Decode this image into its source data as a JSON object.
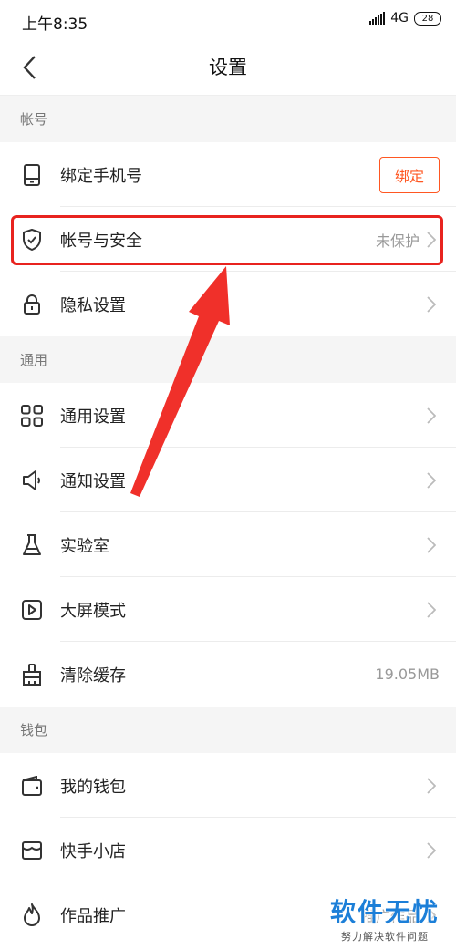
{
  "status_bar": {
    "time": "上午8:35",
    "network": "4G",
    "battery": "28"
  },
  "nav": {
    "title": "设置"
  },
  "sections": {
    "account": {
      "header": "帐号",
      "items": [
        {
          "label": "绑定手机号",
          "button": "绑定"
        },
        {
          "label": "帐号与安全",
          "value": "未保护"
        },
        {
          "label": "隐私设置"
        }
      ]
    },
    "general": {
      "header": "通用",
      "items": [
        {
          "label": "通用设置"
        },
        {
          "label": "通知设置"
        },
        {
          "label": "实验室"
        },
        {
          "label": "大屏模式"
        },
        {
          "label": "清除缓存",
          "value": "19.05MB"
        }
      ]
    },
    "wallet": {
      "header": "钱包",
      "items": [
        {
          "label": "我的钱包"
        },
        {
          "label": "快手小店"
        },
        {
          "label": "作品推广",
          "value": "推广作品"
        }
      ]
    }
  },
  "watermark": {
    "title": "软件无忧",
    "subtitle": "努力解决软件问题"
  },
  "colors": {
    "accent": "#ff5722",
    "annotation_red": "#e8231f",
    "watermark_blue": "#1c7fd8"
  }
}
